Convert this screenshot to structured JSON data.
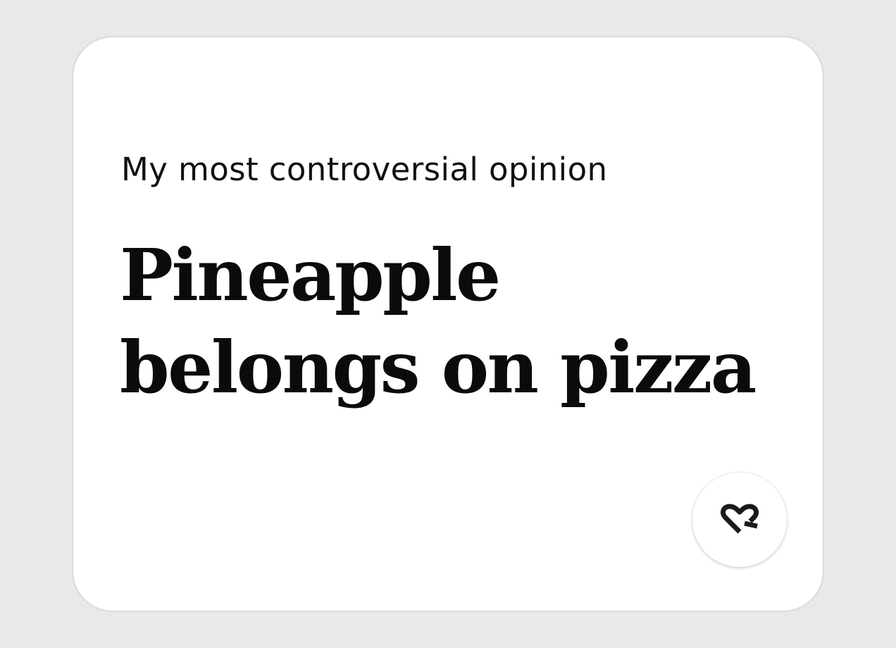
{
  "card": {
    "prompt": "My most controversial opinion",
    "answer": "Pineapple belongs on pizza"
  },
  "like_button": {
    "icon": "heart-icon",
    "background": "#ffffff"
  },
  "colors": {
    "page_background": "#e9e9e9",
    "card_background": "#ffffff",
    "text": "#111111"
  }
}
